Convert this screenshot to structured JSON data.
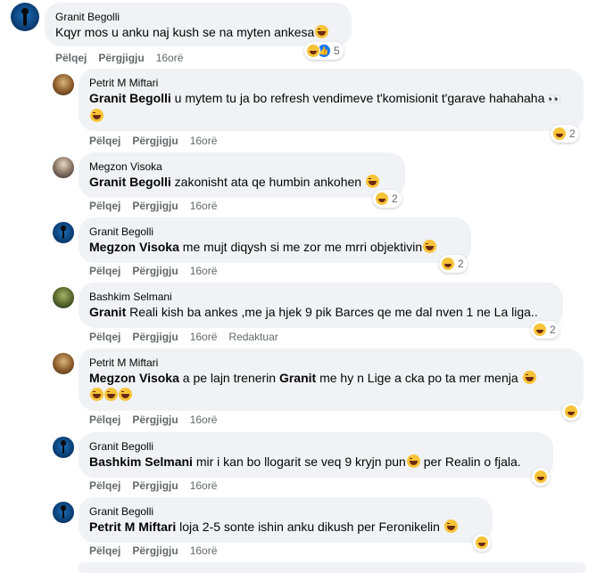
{
  "actions": {
    "like": "Pëlqej",
    "reply": "Përgjigju"
  },
  "comments": [
    {
      "author": "Granit Begolli",
      "text": "Kqyr mos u anku naj kush se na myten ankesa",
      "time": "16orë",
      "reaction_count": "5"
    },
    {
      "author": "Petrit M Miftari",
      "mention": "Granit Begolli",
      "text": " u mytem tu ja bo refresh vendimeve t'komisionit t'garave hahahaha ",
      "eyes": "👀",
      "time": "16orë",
      "reaction_count": "2"
    },
    {
      "author": "Megzon Visoka",
      "mention": "Granit Begolli",
      "text": " zakonisht ata qe humbin ankohen ",
      "time": "16orë",
      "reaction_count": "2"
    },
    {
      "author": "Granit Begolli",
      "mention": "Megzon Visoka",
      "text": " me mujt diqysh si me zor me mrri objektivin",
      "time": "16orë",
      "reaction_count": "2"
    },
    {
      "author": "Bashkim Selmani",
      "mention": "Granit",
      "text": " Reali kish ba ankes ,me ja hjek 9 pik Barces qe me dal nven 1 ne La liga..",
      "time": "16orë",
      "edited": "Redaktuar",
      "reaction_count": "2"
    },
    {
      "author": "Petrit M Miftari",
      "mention": "Megzon Visoka",
      "text_a": " a pe lajn trenerin ",
      "mention_b": "Granit",
      "text_b": " me hy n Lige a cka po ta mer menja ",
      "time": "16orë"
    },
    {
      "author": "Granit Begolli",
      "mention": "Bashkim Selmani",
      "text_a": " mir i kan bo llogarit se veq 9 kryjn pun",
      "text_b": " per Realin o fjala.",
      "time": "16orë"
    },
    {
      "author": "Granit Begolli",
      "mention": "Petrit M Miftari",
      "text": " loja 2-5 sonte ishin anku dikush per Feronikelin ",
      "time": "16orë"
    }
  ],
  "icons": {
    "laugh": "laughing-emoji-icon",
    "like": "like-icon",
    "more": "more-options-icon"
  },
  "colors": {
    "bubble": "#f0f2f5",
    "meta": "#65676b",
    "like_blue": "#1877f2",
    "emoji_yellow": "#f7c338"
  }
}
